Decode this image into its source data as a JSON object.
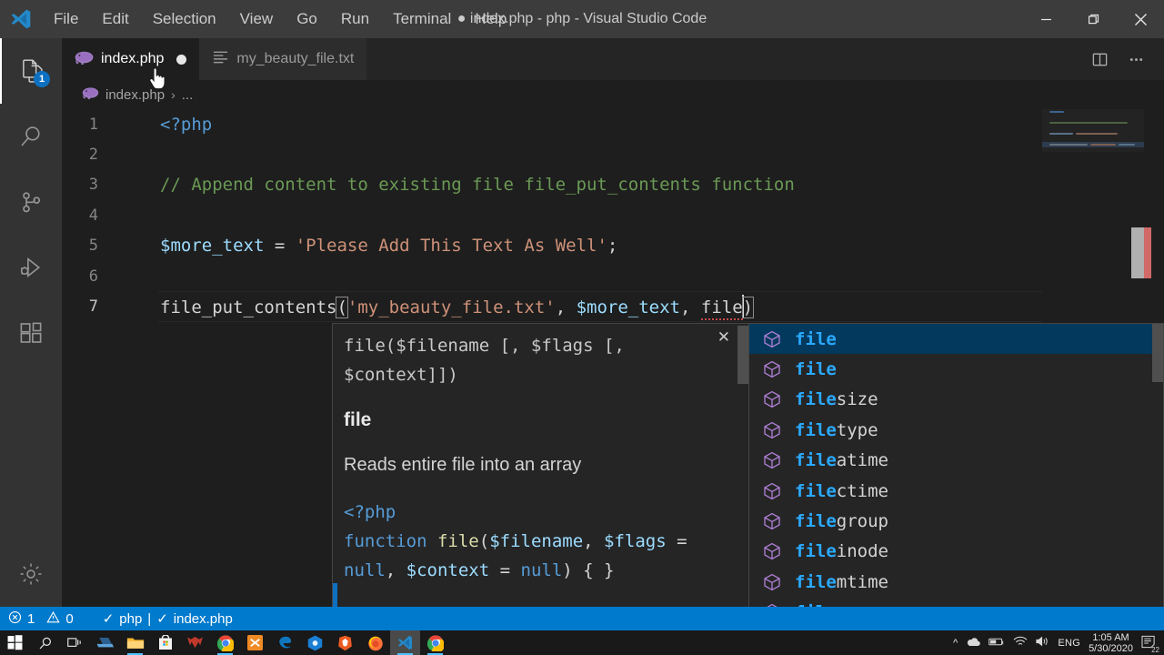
{
  "window": {
    "title": "● index.php - php - Visual Studio Code",
    "minimize_label": "—",
    "maximize_label": "❐",
    "close_label": "✕"
  },
  "menubar": {
    "items": [
      {
        "label": "File"
      },
      {
        "label": "Edit"
      },
      {
        "label": "Selection"
      },
      {
        "label": "View"
      },
      {
        "label": "Go"
      },
      {
        "label": "Run"
      },
      {
        "label": "Terminal"
      },
      {
        "label": "Help"
      }
    ]
  },
  "activitybar": {
    "items": [
      {
        "name": "explorer",
        "icon": "files-icon",
        "badge": "1",
        "active": true
      },
      {
        "name": "search",
        "icon": "search-icon",
        "badge": "",
        "active": false
      },
      {
        "name": "source-control",
        "icon": "source-control-icon",
        "badge": "",
        "active": false
      },
      {
        "name": "run-debug",
        "icon": "run-and-debug-icon",
        "badge": "",
        "active": false
      },
      {
        "name": "extensions",
        "icon": "extensions-icon",
        "badge": "",
        "active": false
      },
      {
        "name": "manage",
        "icon": "gear-icon",
        "badge": "",
        "active": false
      }
    ]
  },
  "tabs": [
    {
      "label": "index.php",
      "icon": "php-file-icon",
      "active": true,
      "dirty": true
    },
    {
      "label": "my_beauty_file.txt",
      "icon": "text-file-icon",
      "active": false,
      "dirty": false
    }
  ],
  "tab_actions": {
    "split_editor": "split-editor-right-icon",
    "more_actions": "more-actions-icon"
  },
  "breadcrumbs": {
    "file": "index.php",
    "separator": "›",
    "tail": "..."
  },
  "editor": {
    "lines": [
      {
        "no": "1",
        "segments": [
          {
            "t": "<?php",
            "c": "tok-tag"
          }
        ]
      },
      {
        "no": "2",
        "segments": []
      },
      {
        "no": "3",
        "segments": [
          {
            "t": "// Append content to existing file file_put_contents function",
            "c": "tok-com"
          }
        ]
      },
      {
        "no": "4",
        "segments": []
      },
      {
        "no": "5",
        "segments": [
          {
            "t": "$more_text",
            "c": "tok-var"
          },
          {
            "t": " = ",
            "c": "tok-plain"
          },
          {
            "t": "'Please Add This Text As Well'",
            "c": "tok-str"
          },
          {
            "t": ";",
            "c": "tok-plain"
          }
        ]
      },
      {
        "no": "6",
        "segments": []
      },
      {
        "no": "7",
        "segments": [
          {
            "t": "file_put_contents",
            "c": "tok-plain"
          },
          {
            "t": "(",
            "c": "tok-plain"
          },
          {
            "t": "'my_beauty_file.txt'",
            "c": "tok-str"
          },
          {
            "t": ", ",
            "c": "tok-plain"
          },
          {
            "t": "$more_text",
            "c": "tok-var"
          },
          {
            "t": ", ",
            "c": "tok-plain"
          },
          {
            "t": "file",
            "c": "tok-err"
          },
          {
            "t": ")",
            "c": "tok-plain"
          }
        ]
      }
    ],
    "cursor_line": "7"
  },
  "suggest": {
    "match_prefix": "file",
    "items": [
      {
        "label": "file",
        "match": "file",
        "rest": "",
        "selected": true
      },
      {
        "label": "file",
        "match": "file",
        "rest": "",
        "selected": false
      },
      {
        "label": "filesize",
        "match": "file",
        "rest": "size",
        "selected": false
      },
      {
        "label": "filetype",
        "match": "file",
        "rest": "type",
        "selected": false
      },
      {
        "label": "fileatime",
        "match": "file",
        "rest": "atime",
        "selected": false
      },
      {
        "label": "filectime",
        "match": "file",
        "rest": "ctime",
        "selected": false
      },
      {
        "label": "filegroup",
        "match": "file",
        "rest": "group",
        "selected": false
      },
      {
        "label": "fileinode",
        "match": "file",
        "rest": "inode",
        "selected": false
      },
      {
        "label": "filemtime",
        "match": "file",
        "rest": "mtime",
        "selected": false
      },
      {
        "label": "fileowner",
        "match": "file",
        "rest": "owner",
        "selected": false
      }
    ]
  },
  "docs": {
    "signature": "file($filename [, $flags [, $context]])",
    "close_label": "✕",
    "title": "file",
    "description": "Reads entire file into an array",
    "code": [
      {
        "t": "<?php",
        "c": "tok-tag"
      },
      {
        "t": "\n",
        "c": "tok-plain"
      },
      {
        "t": "function",
        "c": "tok-kw"
      },
      {
        "t": " ",
        "c": "tok-plain"
      },
      {
        "t": "file",
        "c": "tok-fn"
      },
      {
        "t": "(",
        "c": "tok-plain"
      },
      {
        "t": "$filename",
        "c": "tok-var"
      },
      {
        "t": ", ",
        "c": "tok-plain"
      },
      {
        "t": "$flags",
        "c": "tok-var"
      },
      {
        "t": " = ",
        "c": "tok-plain"
      },
      {
        "t": "null",
        "c": "tok-kw"
      },
      {
        "t": ", ",
        "c": "tok-plain"
      },
      {
        "t": "$context",
        "c": "tok-var"
      },
      {
        "t": " = ",
        "c": "tok-plain"
      },
      {
        "t": "null",
        "c": "tok-kw"
      },
      {
        "t": ") { }",
        "c": "tok-plain"
      }
    ]
  },
  "statusbar": {
    "error_icon": "error-circle-icon",
    "error_count": "1",
    "warning_icon": "warning-triangle-icon",
    "warning_count": "0",
    "intelephense_check": "✓",
    "language": "php",
    "divider": "|",
    "file_check": "✓",
    "file": "index.php",
    "background": "#007acc"
  },
  "taskbar": {
    "icons": [
      {
        "name": "start-icon",
        "running": false,
        "focused": false
      },
      {
        "name": "search-icon",
        "running": false,
        "focused": false
      },
      {
        "name": "task-view-icon",
        "running": false,
        "focused": false
      },
      {
        "name": "file-explorer-pin-icon",
        "running": false,
        "focused": false
      },
      {
        "name": "file-explorer-icon",
        "running": true,
        "focused": false
      },
      {
        "name": "microsoft-store-icon",
        "running": false,
        "focused": false
      },
      {
        "name": "predator-sense-icon",
        "running": false,
        "focused": false
      },
      {
        "name": "chrome-icon",
        "running": true,
        "focused": false
      },
      {
        "name": "xampp-icon",
        "running": false,
        "focused": false
      },
      {
        "name": "edge-icon",
        "running": false,
        "focused": false
      },
      {
        "name": "blue-hexagon-icon",
        "running": false,
        "focused": false
      },
      {
        "name": "brave-icon",
        "running": false,
        "focused": false
      },
      {
        "name": "firefox-icon",
        "running": false,
        "focused": false
      },
      {
        "name": "vscode-icon",
        "running": true,
        "focused": true
      },
      {
        "name": "chrome-icon-2",
        "running": true,
        "focused": false
      }
    ],
    "tray": {
      "chevron": "^",
      "cloud_icon": "onedrive-icon",
      "battery_icon": "battery-icon",
      "network_icon": "wifi-icon",
      "volume_icon": "speaker-icon",
      "language": "ENG",
      "time": "1:05 AM",
      "date": "5/30/2020",
      "notifications_icon": "notifications-icon",
      "notifications_count": "22"
    }
  }
}
